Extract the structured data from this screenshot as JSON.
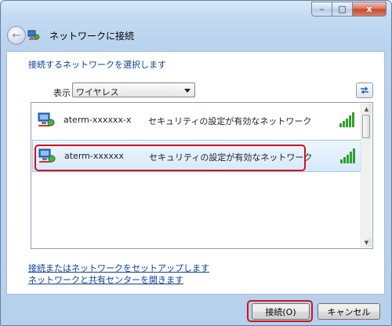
{
  "window": {
    "caption_buttons": [
      "–",
      "□",
      "x"
    ]
  },
  "nav": {
    "title": "ネットワークに接続"
  },
  "main": {
    "heading": "接続するネットワークを選択します",
    "show_label": "表示",
    "filter_value": "ワイヤレス",
    "networks": [
      {
        "ssid": "aterm-xxxxxx-x",
        "security": "セキュリティの設定が有効なネットワーク",
        "signal_bars": 5,
        "selected": false
      },
      {
        "ssid": "aterm-xxxxxx",
        "security": "セキュリティの設定が有効なネットワーク",
        "signal_bars": 5,
        "selected": true
      }
    ]
  },
  "links": {
    "setup": "接続またはネットワークをセットアップします",
    "sharing_center": "ネットワークと共有センターを開きます"
  },
  "footer": {
    "connect_label": "接続(O)",
    "cancel_label": "キャンセル"
  },
  "colors": {
    "highlight": "#d5101a",
    "link": "#0b3f9a",
    "signal": "#2fa02f"
  }
}
